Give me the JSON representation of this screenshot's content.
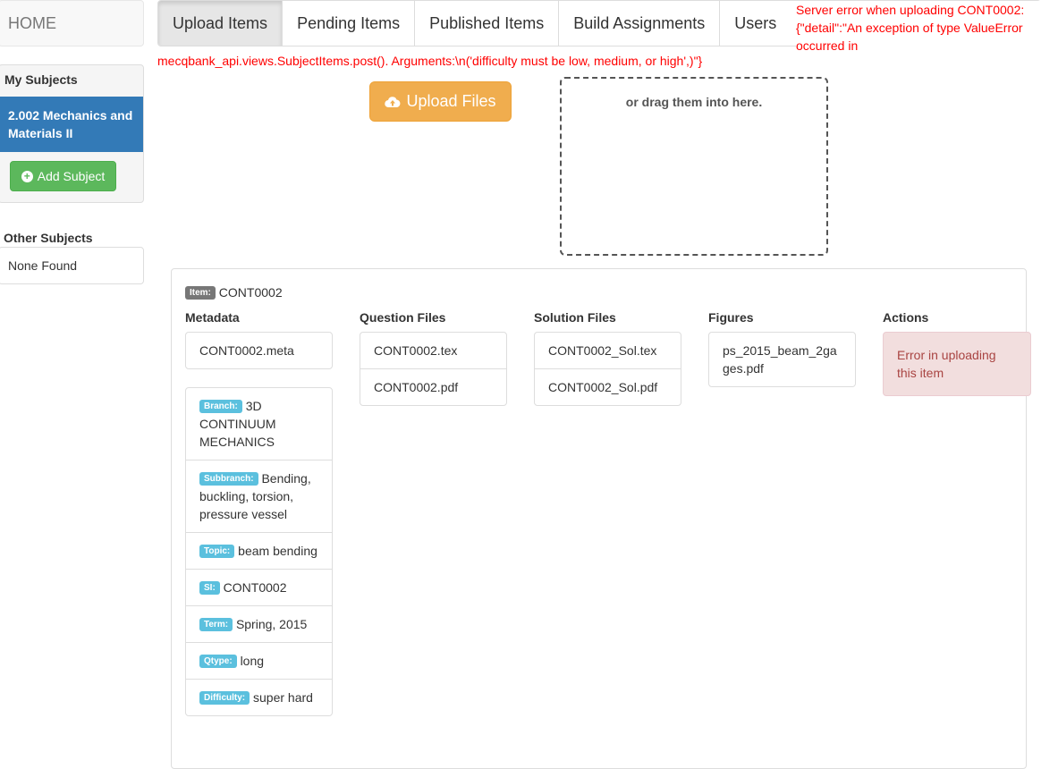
{
  "sidebar": {
    "home": "HOME",
    "my_subjects_heading": "My Subjects",
    "active_subject": "2.002 Mechanics and Materials II",
    "add_subject_label": "Add Subject",
    "other_subjects_heading": "Other Subjects",
    "other_subjects_empty": "None Found"
  },
  "tabs": [
    {
      "label": "Upload Items",
      "active": true
    },
    {
      "label": "Pending Items",
      "active": false
    },
    {
      "label": "Published Items",
      "active": false
    },
    {
      "label": "Build Assignments",
      "active": false
    },
    {
      "label": "Users",
      "active": false
    }
  ],
  "errors": {
    "top_right": "Server error when uploading CONT0002: {\"detail\":\"An exception of type ValueError occurred in",
    "line": "mecqbank_api.views.SubjectItems.post(). Arguments:\\n('difficulty must be low, medium, or high',)\"}"
  },
  "upload": {
    "button_label": "Upload Files",
    "button_icon": "cloud-upload-icon",
    "dropzone_text": "or drag them into here."
  },
  "item": {
    "tag": "Item:",
    "id": "CONT0002",
    "columns": {
      "metadata": "Metadata",
      "question_files": "Question Files",
      "solution_files": "Solution Files",
      "figures": "Figures",
      "actions": "Actions"
    },
    "meta_file": "CONT0002.meta",
    "question_files": [
      "CONT0002.tex",
      "CONT0002.pdf"
    ],
    "solution_files": [
      "CONT0002_Sol.tex",
      "CONT0002_Sol.pdf"
    ],
    "figures": [
      "ps_2015_beam_2gages.pdf"
    ],
    "actions_error": "Error in uploading this item",
    "metadata_fields": [
      {
        "key": "Branch:",
        "value": "3D CONTINUUM MECHANICS"
      },
      {
        "key": "Subbranch:",
        "value": "Bending, buckling, torsion, pressure vessel"
      },
      {
        "key": "Topic:",
        "value": "beam bending"
      },
      {
        "key": "SI:",
        "value": "CONT0002"
      },
      {
        "key": "Term:",
        "value": "Spring, 2015"
      },
      {
        "key": "Qtype:",
        "value": "long"
      },
      {
        "key": "Difficulty:",
        "value": "super hard"
      }
    ]
  },
  "colors": {
    "primary": "#337ab7",
    "success": "#5cb85c",
    "warning": "#f0ad4e",
    "info_label": "#5bc0de",
    "error_text": "#ff0000",
    "danger_bg": "#f2dede"
  }
}
